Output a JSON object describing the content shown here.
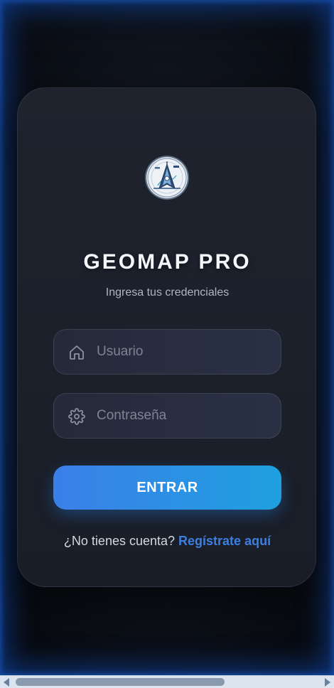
{
  "login": {
    "title": "GEOMAP PRO",
    "subtitle": "Ingresa tus credenciales",
    "username": {
      "placeholder": "Usuario",
      "value": "",
      "icon": "home-icon"
    },
    "password": {
      "placeholder": "Contraseña",
      "value": "",
      "icon": "gear-icon"
    },
    "submit_label": "ENTRAR",
    "register_prompt": "¿No tienes cuenta?",
    "register_link": "Regístrate aquí"
  },
  "colors": {
    "accent_start": "#3b7fe8",
    "accent_end": "#1fa0e0",
    "link": "#3d7fe0",
    "card_bg": "#1e232e",
    "page_glow": "#1456d2"
  },
  "logo": {
    "icon": "geomap-logo-icon"
  }
}
